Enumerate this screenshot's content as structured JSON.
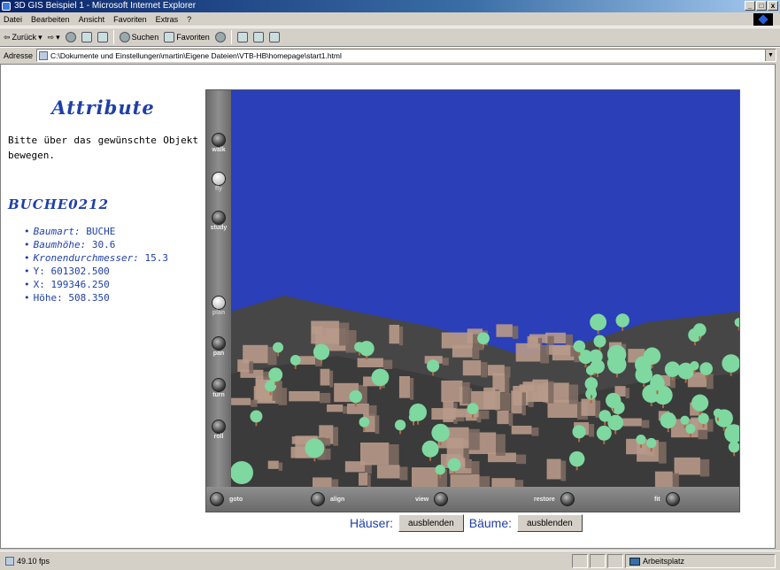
{
  "window": {
    "title": "3D GIS Beispiel 1 - Microsoft Internet Explorer",
    "buttons": [
      "_",
      "□",
      "x"
    ]
  },
  "menu": [
    "Datei",
    "Bearbeiten",
    "Ansicht",
    "Favoriten",
    "Extras",
    "?"
  ],
  "toolbar": {
    "back": "Zurück",
    "search": "Suchen",
    "favorites": "Favoriten"
  },
  "address": {
    "label": "Adresse",
    "value": "C:\\Dokumente und Einstellungen\\martin\\Eigene Dateien\\VTB-HB\\homepage\\start1.html"
  },
  "page": {
    "title": "Attribute",
    "instruction": "Bitte über das gewünschte Objekt bewegen.",
    "object_id": "BUCHE0212",
    "attributes": [
      {
        "key": "Baumart:",
        "value": "BUCHE",
        "italic": true
      },
      {
        "key": "Baumhöhe:",
        "value": "30.6",
        "italic": true
      },
      {
        "key": "Kronendurchmesser:",
        "value": "15.3",
        "italic": true
      },
      {
        "key": "Y:",
        "value": "601302.500",
        "italic": false
      },
      {
        "key": "X:",
        "value": "199346.250",
        "italic": false
      },
      {
        "key": "Höhe:",
        "value": "508.350",
        "italic": false
      }
    ]
  },
  "viewer": {
    "nav": [
      {
        "label": "walk",
        "active": false
      },
      {
        "label": "fly",
        "active": true
      },
      {
        "label": "study",
        "active": false
      },
      {
        "label": "plan",
        "active": true
      },
      {
        "label": "pan",
        "active": false
      },
      {
        "label": "turn",
        "active": false
      },
      {
        "label": "roll",
        "active": false
      }
    ],
    "bottom": [
      "goto",
      "align",
      "view",
      "restore",
      "fit"
    ],
    "colors": {
      "sky": "#2a3fb8",
      "terrain": "#3b3b3b",
      "building": "#b89a8a",
      "tree": "#7ed8a0"
    }
  },
  "controls": {
    "houses_label": "Häuser:",
    "houses_button": "ausblenden",
    "trees_label": "Bäume:",
    "trees_button": "ausblenden"
  },
  "status": {
    "text": "49.10 fps",
    "zone": "Arbeitsplatz"
  }
}
